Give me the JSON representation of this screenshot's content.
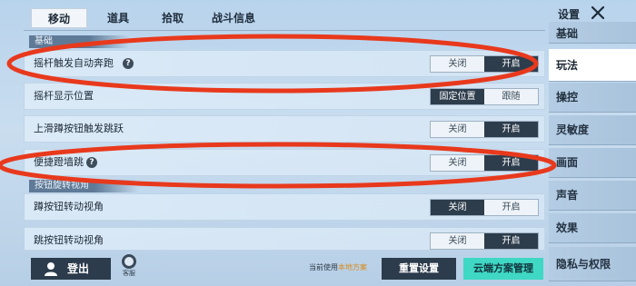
{
  "tabs": [
    {
      "label": "移动",
      "active": true
    },
    {
      "label": "道具",
      "active": false
    },
    {
      "label": "拾取",
      "active": false
    },
    {
      "label": "战斗信息",
      "active": false
    }
  ],
  "sections": {
    "basic": "基础",
    "button_rotate": "按钮旋转视角"
  },
  "settings": {
    "joystick_auto_run": {
      "label": "摇杆触发自动奔跑",
      "options": [
        "关闭",
        "开启"
      ],
      "selected": "开启"
    },
    "joystick_position": {
      "label": "摇杆显示位置",
      "options": [
        "固定位置",
        "跟随"
      ],
      "selected": "固定位置"
    },
    "swipe_crouch_jump": {
      "label": "上滑蹲按钮触发跳跃",
      "options": [
        "关闭",
        "开启"
      ],
      "selected": "开启"
    },
    "quick_wall_jump": {
      "label": "便捷蹬墙跳",
      "options": [
        "关闭",
        "开启"
      ],
      "selected": "开启"
    },
    "crouch_rotate": {
      "label": "蹲按钮转动视角",
      "options": [
        "关闭",
        "开启"
      ],
      "selected": "关闭"
    },
    "jump_rotate": {
      "label": "跳按钮转动视角",
      "options": [
        "关闭",
        "开启"
      ],
      "selected": "开启"
    }
  },
  "bottom_bar": {
    "logout_label": "登出",
    "service_label": "客服",
    "scheme_prefix": "当前使用",
    "scheme_name": "本地方案",
    "reset_label": "重置设置",
    "cloud_label": "云端方案管理"
  },
  "sidebar": {
    "title": "设置",
    "items": [
      {
        "label": "基础",
        "active": false
      },
      {
        "label": "玩法",
        "active": true
      },
      {
        "label": "操控",
        "active": false
      },
      {
        "label": "灵敏度",
        "active": false
      },
      {
        "label": "画面",
        "active": false
      },
      {
        "label": "声音",
        "active": false
      },
      {
        "label": "效果",
        "active": false
      },
      {
        "label": "隐私与权限",
        "active": false
      }
    ]
  },
  "colors": {
    "annotation": "#e8391d",
    "toggle_on": "#2e3d4c",
    "cloud_button": "#3fd8c4",
    "scheme_link": "#d88a1a"
  }
}
